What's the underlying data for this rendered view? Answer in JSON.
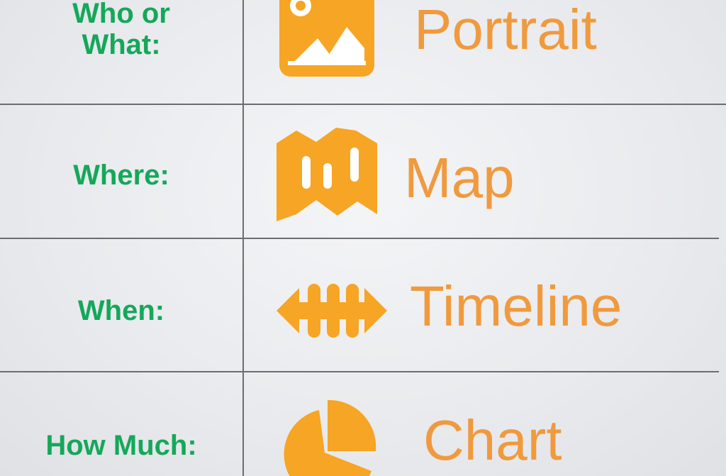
{
  "colors": {
    "label": "#14a85a",
    "word": "#f09a3e",
    "icon": "#f6a524",
    "line": "#6b6d70",
    "background": "#e9eaed"
  },
  "rows": [
    {
      "label_lines": [
        "Who or",
        "What:"
      ],
      "word": "Portrait",
      "icon": "image-icon"
    },
    {
      "label_lines": [
        "Where:"
      ],
      "word": "Map",
      "icon": "map-icon"
    },
    {
      "label_lines": [
        "When:"
      ],
      "word": "Timeline",
      "icon": "timeline-icon"
    },
    {
      "label_lines": [
        "How Much:"
      ],
      "word": "Chart",
      "icon": "pie-chart-icon"
    }
  ]
}
